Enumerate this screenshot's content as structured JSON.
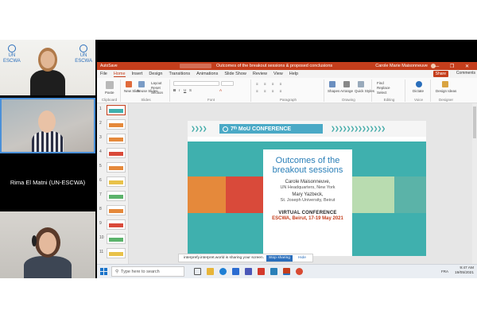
{
  "participants": {
    "speaker_label": "Rima El Matni (UN-ESCWA)"
  },
  "window": {
    "autosave": "AutoSave",
    "title": "Outcomes of the breakout sessions & proposed conclusions",
    "user": "Carole Marie Maisonneuve",
    "controls": "—  ❐  ✕"
  },
  "menu": {
    "tabs": [
      "File",
      "Home",
      "Insert",
      "Design",
      "Transitions",
      "Animations",
      "Slide Show",
      "Review",
      "View",
      "Help"
    ],
    "share": "Share",
    "comments": "Comments"
  },
  "ribbon": {
    "paste": "Paste",
    "new_slide": "New Slide",
    "reuse_slides": "Reuse Slides",
    "layout": "Layout",
    "reset": "Reset",
    "section": "Section",
    "shapes": "Shapes",
    "arrange": "Arrange",
    "quick_styles": "Quick Styles",
    "find": "Find",
    "replace": "Replace",
    "select": "Select",
    "dictate": "Dictate",
    "design_ideas": "Design Ideas",
    "groups": {
      "clipboard": "Clipboard",
      "slides": "Slides",
      "font": "Font",
      "paragraph": "Paragraph",
      "drawing": "Drawing",
      "editing": "Editing",
      "voice": "Voice",
      "designer": "Designer"
    }
  },
  "thumbnails": [
    "1",
    "2",
    "3",
    "4",
    "5",
    "6",
    "7",
    "8",
    "9",
    "10",
    "11"
  ],
  "slide": {
    "conference": "7ᵗʰ MoU CONFERENCE",
    "title": "Outcomes of the breakout sessions",
    "author1": "Carole Maisonneuve,",
    "author1_org": "UN Headquarters, New York",
    "author2": "Mary Yazbeck,",
    "author2_org": "St. Joseph University, Beirut",
    "virtual": "VIRTUAL CONFERENCE",
    "dates": "ESCWA, Beirut, 17-19 May 2021"
  },
  "status": {
    "slide_of": "Slide 1 of 12",
    "language": "English (United States)",
    "notes": "Notes",
    "display": "Display Settings",
    "zoom": "61%"
  },
  "share_banner": {
    "text": "interprefy.interpret.world is sharing your screen.",
    "stop": "Stop sharing",
    "hide": "Hide"
  },
  "taskbar": {
    "search_placeholder": "Type here to search",
    "lang": "FRA",
    "time": "9:47 AM",
    "date": "19/05/2021"
  },
  "colors": {
    "office_accent": "#c43e1c",
    "slide_teal": "#3fb0ae",
    "title_blue": "#2a7fb8",
    "banner_blue": "#4aa9c6"
  }
}
